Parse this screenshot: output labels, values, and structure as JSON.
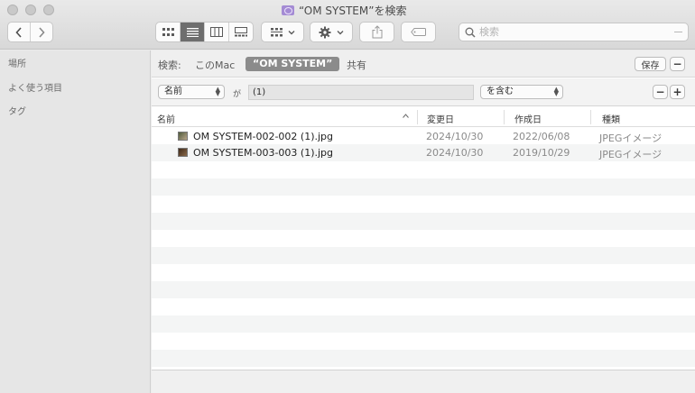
{
  "window": {
    "title": "“OM SYSTEM”を検索",
    "folder_icon": "smart-folder-icon"
  },
  "toolbar": {
    "back_icon": "chevron-left-icon",
    "forward_icon": "chevron-right-icon",
    "view_modes": [
      "icon-view-icon",
      "list-view-icon",
      "column-view-icon",
      "gallery-view-icon"
    ],
    "active_view": "list-view-icon",
    "group_icon": "group-by-icon",
    "action_icon": "gear-icon",
    "share_icon": "share-icon",
    "tag_icon": "tag-icon",
    "search_placeholder": "検索",
    "search_value": ""
  },
  "sidebar": {
    "sections": [
      {
        "label": "場所"
      },
      {
        "label": "よく使う項目"
      },
      {
        "label": "タグ"
      }
    ]
  },
  "scope": {
    "label": "検索:",
    "options": [
      {
        "label": "このMac",
        "active": false
      },
      {
        "label": "“OM SYSTEM”",
        "active": true
      },
      {
        "label": "共有",
        "active": false
      }
    ],
    "save_label": "保存",
    "remove_label": "−"
  },
  "criteria": {
    "attribute": "名前",
    "connector": "が",
    "value": "(1)",
    "operator": "を含む",
    "remove_label": "−",
    "add_label": "+"
  },
  "columns": [
    {
      "label": "名前",
      "sorted": true
    },
    {
      "label": "変更日"
    },
    {
      "label": "作成日"
    },
    {
      "label": "種類"
    }
  ],
  "files": [
    {
      "name": "OM SYSTEM-002-002 (1).jpg",
      "modified": "2024/10/30",
      "created": "2022/06/08",
      "kind": "JPEGイメージ"
    },
    {
      "name": "OM SYSTEM-003-003 (1).jpg",
      "modified": "2024/10/30",
      "created": "2019/10/29",
      "kind": "JPEGイメージ"
    }
  ],
  "colors": {
    "row_stripe": "#f4f5f5",
    "selected_segment": "#6e6e6e"
  }
}
